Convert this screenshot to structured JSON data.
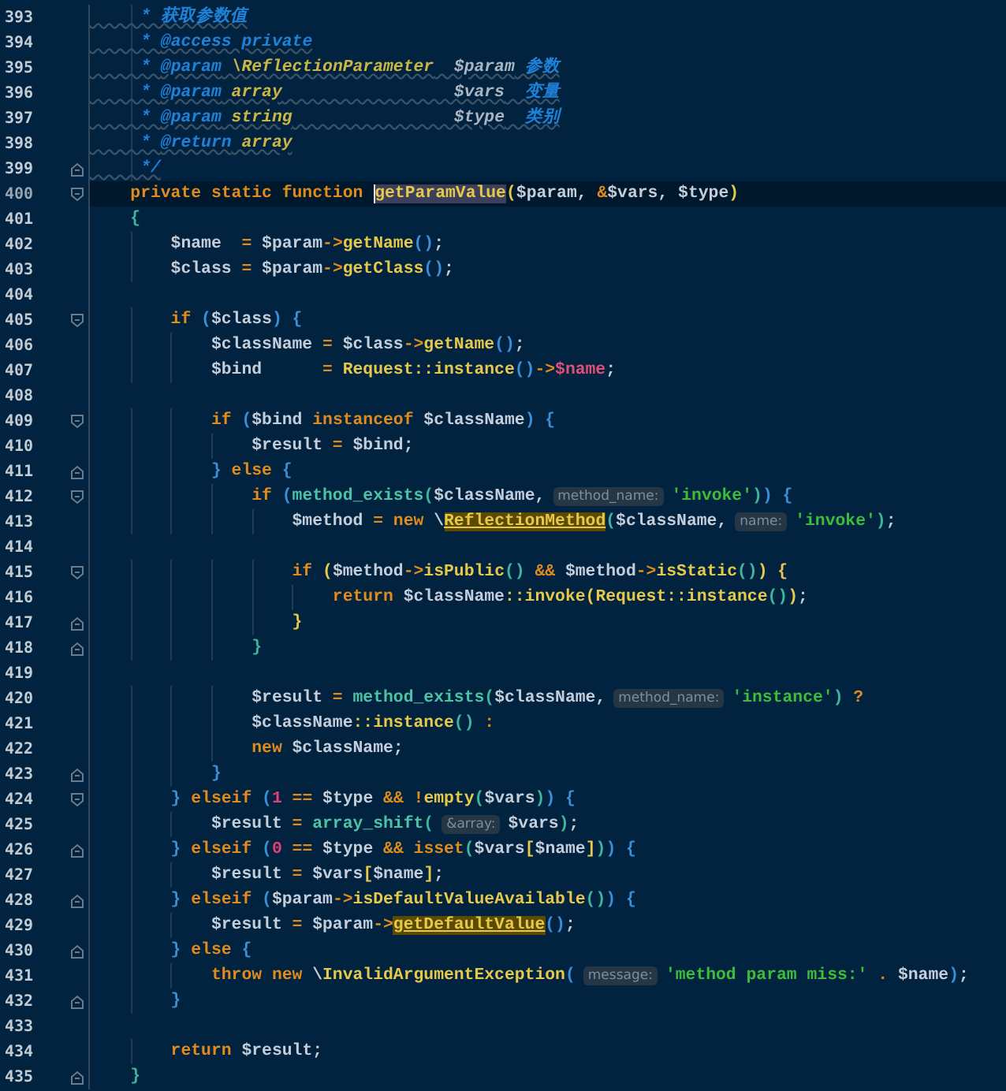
{
  "lines": [
    {
      "number": "393",
      "current": false,
      "tokens": [
        {
          "kind": "cmt",
          "text": "     * 获取参数值"
        }
      ]
    },
    {
      "number": "394",
      "current": false,
      "tokens": [
        {
          "kind": "cmt",
          "text": "     * "
        },
        {
          "kind": "tag",
          "text": "@access private"
        }
      ]
    },
    {
      "number": "395",
      "current": false,
      "tokens": [
        {
          "kind": "cmt",
          "text": "     * "
        },
        {
          "kind": "tag",
          "text": "@param"
        },
        {
          "kind": "type",
          "text": " \\ReflectionParameter"
        },
        {
          "kind": "cvar",
          "text": "  $param"
        },
        {
          "kind": "cmt",
          "text": " 参数"
        }
      ]
    },
    {
      "number": "396",
      "current": false,
      "tokens": [
        {
          "kind": "cmt",
          "text": "     * "
        },
        {
          "kind": "tag",
          "text": "@param"
        },
        {
          "kind": "type",
          "text": " array"
        },
        {
          "kind": "cvar",
          "text": "                 $vars"
        },
        {
          "kind": "cmt",
          "text": "  变量"
        }
      ]
    },
    {
      "number": "397",
      "current": false,
      "tokens": [
        {
          "kind": "cmt",
          "text": "     * "
        },
        {
          "kind": "tag",
          "text": "@param"
        },
        {
          "kind": "type",
          "text": " string"
        },
        {
          "kind": "cvar",
          "text": "                $type"
        },
        {
          "kind": "cmt",
          "text": "  类别"
        }
      ]
    },
    {
      "number": "398",
      "current": false,
      "tokens": [
        {
          "kind": "cmt",
          "text": "     * "
        },
        {
          "kind": "tag",
          "text": "@return"
        },
        {
          "kind": "type",
          "text": " array"
        }
      ]
    },
    {
      "number": "399",
      "current": false,
      "fold_end": true,
      "tokens": [
        {
          "kind": "cmt",
          "text": "     */"
        }
      ]
    },
    {
      "number": "400",
      "current": true,
      "fold_start": true,
      "tokens": [
        {
          "kind": "kw",
          "text": "    private static function "
        },
        {
          "kind": "fn",
          "text": "getParamValue",
          "selected": true,
          "caret": true
        },
        {
          "kind": "p1",
          "text": "("
        },
        {
          "kind": "var",
          "text": "$param"
        },
        {
          "kind": "plain",
          "text": ", "
        },
        {
          "kind": "op",
          "text": "&"
        },
        {
          "kind": "var",
          "text": "$vars"
        },
        {
          "kind": "plain",
          "text": ", "
        },
        {
          "kind": "var",
          "text": "$type"
        },
        {
          "kind": "p1",
          "text": ")"
        }
      ]
    },
    {
      "number": "401",
      "current": false,
      "tokens": [
        {
          "kind": "p3",
          "text": "    {"
        }
      ]
    },
    {
      "number": "402",
      "current": false,
      "tokens": [
        {
          "kind": "var",
          "text": "        $name"
        },
        {
          "kind": "op",
          "text": "  = "
        },
        {
          "kind": "var",
          "text": "$param"
        },
        {
          "kind": "op",
          "text": "->"
        },
        {
          "kind": "fn",
          "text": "getName"
        },
        {
          "kind": "p2",
          "text": "()"
        },
        {
          "kind": "plain",
          "text": ";"
        }
      ]
    },
    {
      "number": "403",
      "current": false,
      "tokens": [
        {
          "kind": "var",
          "text": "        $class"
        },
        {
          "kind": "op",
          "text": " = "
        },
        {
          "kind": "var",
          "text": "$param"
        },
        {
          "kind": "op",
          "text": "->"
        },
        {
          "kind": "fn",
          "text": "getClass"
        },
        {
          "kind": "p2",
          "text": "()"
        },
        {
          "kind": "plain",
          "text": ";"
        }
      ]
    },
    {
      "number": "404",
      "current": false
    },
    {
      "number": "405",
      "current": false,
      "fold_start": true,
      "tokens": [
        {
          "kind": "kw",
          "text": "        if"
        },
        {
          "kind": "p2",
          "text": " ("
        },
        {
          "kind": "var",
          "text": "$class"
        },
        {
          "kind": "p2",
          "text": ") {"
        }
      ]
    },
    {
      "number": "406",
      "current": false,
      "tokens": [
        {
          "kind": "var",
          "text": "            $className"
        },
        {
          "kind": "op",
          "text": " = "
        },
        {
          "kind": "var",
          "text": "$class"
        },
        {
          "kind": "op",
          "text": "->"
        },
        {
          "kind": "fn",
          "text": "getName"
        },
        {
          "kind": "p2",
          "text": "()"
        },
        {
          "kind": "plain",
          "text": ";"
        }
      ]
    },
    {
      "number": "407",
      "current": false,
      "tokens": [
        {
          "kind": "var",
          "text": "            $bind"
        },
        {
          "kind": "op",
          "text": "      = "
        },
        {
          "kind": "cls",
          "text": "Request::instance"
        },
        {
          "kind": "p2",
          "text": "()"
        },
        {
          "kind": "op",
          "text": "->"
        },
        {
          "kind": "field",
          "text": "$name"
        },
        {
          "kind": "plain",
          "text": ";"
        }
      ]
    },
    {
      "number": "408",
      "current": false
    },
    {
      "number": "409",
      "current": false,
      "fold_start": true,
      "tokens": [
        {
          "kind": "kw",
          "text": "            if"
        },
        {
          "kind": "p2",
          "text": " ("
        },
        {
          "kind": "var",
          "text": "$bind"
        },
        {
          "kind": "kw",
          "text": " instanceof"
        },
        {
          "kind": "var",
          "text": " $className"
        },
        {
          "kind": "p2",
          "text": ") {"
        }
      ]
    },
    {
      "number": "410",
      "current": false,
      "tokens": [
        {
          "kind": "var",
          "text": "                $result"
        },
        {
          "kind": "op",
          "text": " = "
        },
        {
          "kind": "var",
          "text": "$bind"
        },
        {
          "kind": "plain",
          "text": ";"
        }
      ]
    },
    {
      "number": "411",
      "current": false,
      "fold_end": true,
      "tokens": [
        {
          "kind": "p2",
          "text": "            }"
        },
        {
          "kind": "kw",
          "text": " else"
        },
        {
          "kind": "p2",
          "text": " {"
        }
      ]
    },
    {
      "number": "412",
      "current": false,
      "fold_start": true,
      "tokens": [
        {
          "kind": "kw",
          "text": "                if"
        },
        {
          "kind": "p2",
          "text": " ("
        },
        {
          "kind": "bi",
          "text": "method_exists"
        },
        {
          "kind": "p3",
          "text": "("
        },
        {
          "kind": "var",
          "text": "$className"
        },
        {
          "kind": "plain",
          "text": ","
        },
        {
          "kind": "hint",
          "text": "method_name:"
        },
        {
          "kind": "str",
          "text": "'invoke'"
        },
        {
          "kind": "p3",
          "text": ")"
        },
        {
          "kind": "p2",
          "text": ") {"
        }
      ]
    },
    {
      "number": "413",
      "current": false,
      "tokens": [
        {
          "kind": "var",
          "text": "                    $method"
        },
        {
          "kind": "op",
          "text": " = "
        },
        {
          "kind": "kw",
          "text": "new"
        },
        {
          "kind": "plain",
          "text": " \\"
        },
        {
          "kind": "cls",
          "text": "ReflectionMethod",
          "highlighted": true
        },
        {
          "kind": "p3",
          "text": "("
        },
        {
          "kind": "var",
          "text": "$className"
        },
        {
          "kind": "plain",
          "text": ","
        },
        {
          "kind": "hint",
          "text": "name:"
        },
        {
          "kind": "str",
          "text": "'invoke'"
        },
        {
          "kind": "p3",
          "text": ")"
        },
        {
          "kind": "plain",
          "text": ";"
        }
      ]
    },
    {
      "number": "414",
      "current": false
    },
    {
      "number": "415",
      "current": false,
      "fold_start": true,
      "tokens": [
        {
          "kind": "kw",
          "text": "                    if"
        },
        {
          "kind": "p1",
          "text": " ("
        },
        {
          "kind": "var",
          "text": "$method"
        },
        {
          "kind": "op",
          "text": "->"
        },
        {
          "kind": "fn",
          "text": "isPublic"
        },
        {
          "kind": "p3",
          "text": "()"
        },
        {
          "kind": "op",
          "text": " && "
        },
        {
          "kind": "var",
          "text": "$method"
        },
        {
          "kind": "op",
          "text": "->"
        },
        {
          "kind": "fn",
          "text": "isStatic"
        },
        {
          "kind": "p3",
          "text": "()"
        },
        {
          "kind": "p1",
          "text": ") {"
        }
      ]
    },
    {
      "number": "416",
      "current": false,
      "tokens": [
        {
          "kind": "kw",
          "text": "                        return"
        },
        {
          "kind": "var",
          "text": " $className"
        },
        {
          "kind": "cls",
          "text": "::invoke(Request::instance"
        },
        {
          "kind": "p3",
          "text": "()"
        },
        {
          "kind": "p1",
          "text": ")"
        },
        {
          "kind": "plain",
          "text": ";"
        }
      ]
    },
    {
      "number": "417",
      "current": false,
      "fold_end": true,
      "tokens": [
        {
          "kind": "p1",
          "text": "                    }"
        }
      ]
    },
    {
      "number": "418",
      "current": false,
      "fold_end": true,
      "tokens": [
        {
          "kind": "p3",
          "text": "                }"
        }
      ]
    },
    {
      "number": "419",
      "current": false
    },
    {
      "number": "420",
      "current": false,
      "tokens": [
        {
          "kind": "var",
          "text": "                $result"
        },
        {
          "kind": "op",
          "text": " = "
        },
        {
          "kind": "bi",
          "text": "method_exists"
        },
        {
          "kind": "p3",
          "text": "("
        },
        {
          "kind": "var",
          "text": "$className"
        },
        {
          "kind": "plain",
          "text": ","
        },
        {
          "kind": "hint",
          "text": "method_name:"
        },
        {
          "kind": "str",
          "text": "'instance'"
        },
        {
          "kind": "p3",
          "text": ")"
        },
        {
          "kind": "op",
          "text": " ?"
        }
      ]
    },
    {
      "number": "421",
      "current": false,
      "tokens": [
        {
          "kind": "var",
          "text": "                $className"
        },
        {
          "kind": "cls",
          "text": "::instance"
        },
        {
          "kind": "p3",
          "text": "()"
        },
        {
          "kind": "op",
          "text": " :"
        }
      ]
    },
    {
      "number": "422",
      "current": false,
      "tokens": [
        {
          "kind": "kw",
          "text": "                new"
        },
        {
          "kind": "var",
          "text": " $className"
        },
        {
          "kind": "plain",
          "text": ";"
        }
      ]
    },
    {
      "number": "423",
      "current": false,
      "fold_end": true,
      "tokens": [
        {
          "kind": "p2",
          "text": "            }"
        }
      ]
    },
    {
      "number": "424",
      "current": false,
      "fold_start": true,
      "tokens": [
        {
          "kind": "p2",
          "text": "        }"
        },
        {
          "kind": "kw",
          "text": " elseif"
        },
        {
          "kind": "p2",
          "text": " ("
        },
        {
          "kind": "num",
          "text": "1"
        },
        {
          "kind": "op",
          "text": " == "
        },
        {
          "kind": "var",
          "text": "$type"
        },
        {
          "kind": "op",
          "text": " && !"
        },
        {
          "kind": "fn",
          "text": "empty"
        },
        {
          "kind": "p3",
          "text": "("
        },
        {
          "kind": "var",
          "text": "$vars"
        },
        {
          "kind": "p3",
          "text": ")"
        },
        {
          "kind": "p2",
          "text": ") {"
        }
      ]
    },
    {
      "number": "425",
      "current": false,
      "tokens": [
        {
          "kind": "var",
          "text": "            $result"
        },
        {
          "kind": "op",
          "text": " = "
        },
        {
          "kind": "bi",
          "text": "array_shift"
        },
        {
          "kind": "p3",
          "text": "("
        },
        {
          "kind": "hint",
          "text": "&array:"
        },
        {
          "kind": "var",
          "text": "$vars"
        },
        {
          "kind": "p3",
          "text": ")"
        },
        {
          "kind": "plain",
          "text": ";"
        }
      ]
    },
    {
      "number": "426",
      "current": false,
      "fold_end": true,
      "tokens": [
        {
          "kind": "p2",
          "text": "        }"
        },
        {
          "kind": "kw",
          "text": " elseif"
        },
        {
          "kind": "p2",
          "text": " ("
        },
        {
          "kind": "num",
          "text": "0"
        },
        {
          "kind": "op",
          "text": " == "
        },
        {
          "kind": "var",
          "text": "$type"
        },
        {
          "kind": "op",
          "text": " && "
        },
        {
          "kind": "kw",
          "text": "isset"
        },
        {
          "kind": "p3",
          "text": "("
        },
        {
          "kind": "var",
          "text": "$vars"
        },
        {
          "kind": "p1",
          "text": "["
        },
        {
          "kind": "var",
          "text": "$name"
        },
        {
          "kind": "p1",
          "text": "]"
        },
        {
          "kind": "p3",
          "text": ")"
        },
        {
          "kind": "p2",
          "text": ") {"
        }
      ]
    },
    {
      "number": "427",
      "current": false,
      "tokens": [
        {
          "kind": "var",
          "text": "            $result"
        },
        {
          "kind": "op",
          "text": " = "
        },
        {
          "kind": "var",
          "text": "$vars"
        },
        {
          "kind": "p1",
          "text": "["
        },
        {
          "kind": "var",
          "text": "$name"
        },
        {
          "kind": "p1",
          "text": "]"
        },
        {
          "kind": "plain",
          "text": ";"
        }
      ]
    },
    {
      "number": "428",
      "current": false,
      "fold_end": true,
      "tokens": [
        {
          "kind": "p2",
          "text": "        }"
        },
        {
          "kind": "kw",
          "text": " elseif"
        },
        {
          "kind": "p2",
          "text": " ("
        },
        {
          "kind": "var",
          "text": "$param"
        },
        {
          "kind": "op",
          "text": "->"
        },
        {
          "kind": "fn",
          "text": "isDefaultValueAvailable"
        },
        {
          "kind": "p3",
          "text": "()"
        },
        {
          "kind": "p2",
          "text": ") {"
        }
      ]
    },
    {
      "number": "429",
      "current": false,
      "tokens": [
        {
          "kind": "var",
          "text": "            $result"
        },
        {
          "kind": "op",
          "text": " = "
        },
        {
          "kind": "var",
          "text": "$param"
        },
        {
          "kind": "op",
          "text": "->"
        },
        {
          "kind": "fn",
          "text": "getDefaultValue",
          "highlighted": true
        },
        {
          "kind": "p2",
          "text": "()"
        },
        {
          "kind": "plain",
          "text": ";"
        }
      ]
    },
    {
      "number": "430",
      "current": false,
      "fold_end": true,
      "tokens": [
        {
          "kind": "p2",
          "text": "        }"
        },
        {
          "kind": "kw",
          "text": " else"
        },
        {
          "kind": "p2",
          "text": " {"
        }
      ]
    },
    {
      "number": "431",
      "current": false,
      "tokens": [
        {
          "kind": "kw",
          "text": "            throw new"
        },
        {
          "kind": "plain",
          "text": " \\"
        },
        {
          "kind": "cls",
          "text": "InvalidArgumentException"
        },
        {
          "kind": "p2",
          "text": "("
        },
        {
          "kind": "hint",
          "text": "message:"
        },
        {
          "kind": "str",
          "text": "'method param miss:'"
        },
        {
          "kind": "op",
          "text": " . "
        },
        {
          "kind": "var",
          "text": "$name"
        },
        {
          "kind": "p2",
          "text": ")"
        },
        {
          "kind": "plain",
          "text": ";"
        }
      ]
    },
    {
      "number": "432",
      "current": false,
      "fold_end": true,
      "tokens": [
        {
          "kind": "p2",
          "text": "        }"
        }
      ]
    },
    {
      "number": "433",
      "current": false
    },
    {
      "number": "434",
      "current": false,
      "tokens": [
        {
          "kind": "kw",
          "text": "        return"
        },
        {
          "kind": "var",
          "text": " $result"
        },
        {
          "kind": "plain",
          "text": ";"
        }
      ]
    },
    {
      "number": "435",
      "current": false,
      "fold_end": true,
      "tokens": [
        {
          "kind": "p3",
          "text": "    }"
        }
      ]
    }
  ]
}
